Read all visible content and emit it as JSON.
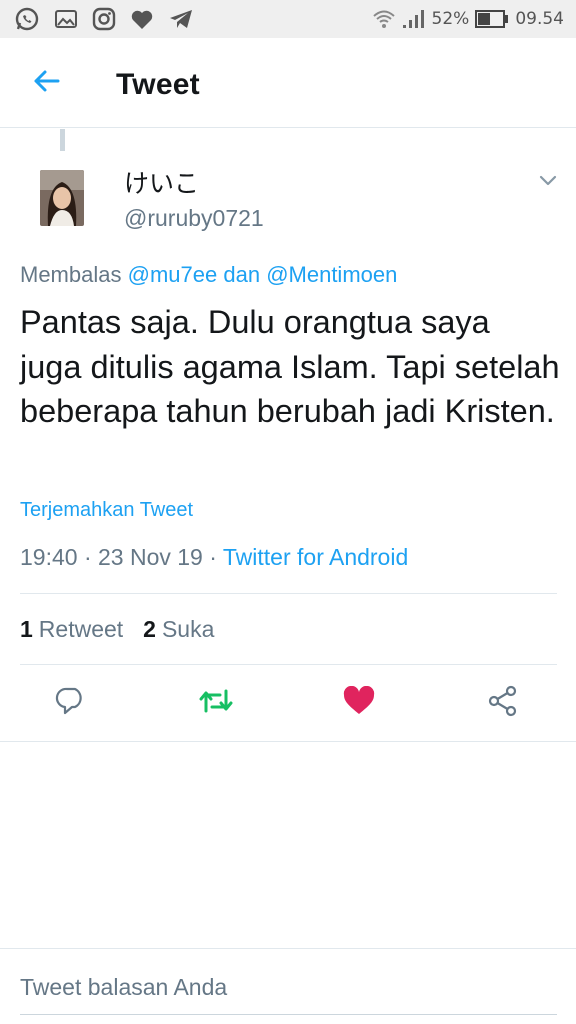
{
  "status_bar": {
    "battery_percent": "52%",
    "time": "09.54",
    "left_icons": [
      "whatsapp-icon",
      "image-icon",
      "instagram-icon",
      "heart-icon",
      "telegram-icon"
    ],
    "right_icons": [
      "wifi-icon",
      "signal-icon",
      "battery-icon"
    ],
    "battery_level": 0.52
  },
  "header": {
    "title": "Tweet",
    "back_icon": "arrow-left-icon"
  },
  "tweet": {
    "display_name": "けいこ",
    "handle": "@ruruby0721",
    "reply_prefix": "Membalas",
    "mention_1": "@mu7ee",
    "reply_connector": "dan",
    "mention_2": "@Mentimoen",
    "text": "Pantas saja. Dulu orangtua saya juga ditulis agama Islam. Tapi setelah beberapa tahun berubah jadi Kristen.",
    "translate_label": "Terjemahkan Tweet",
    "timestamp": "19:40 · 23 Nov 19 ·",
    "source": "Twitter for Android"
  },
  "stats": {
    "retweet_count": "1",
    "retweet_label": "Retweet",
    "like_count": "2",
    "like_label": "Suka"
  },
  "actions": {
    "reply_icon": "reply-icon",
    "retweet_icon": "retweet-icon",
    "like_icon": "heart-filled-icon",
    "share_icon": "share-icon"
  },
  "colors": {
    "accent": "#1da1f2",
    "retweet_active": "#17bf63",
    "like_active": "#e0245e",
    "secondary_text": "#657786",
    "primary_text": "#14171a"
  },
  "reply_composer": {
    "placeholder": "Tweet balasan Anda"
  }
}
